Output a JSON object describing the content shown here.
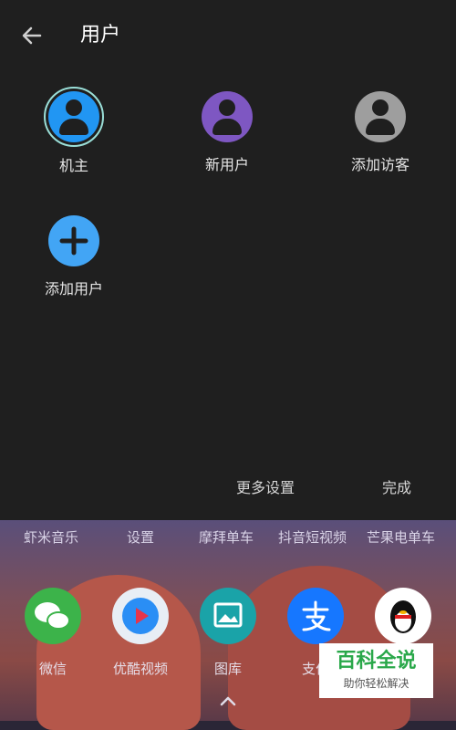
{
  "header": {
    "title": "用户",
    "back_icon": "arrow-left-icon"
  },
  "users": [
    {
      "label": "机主",
      "color": "#2196f3",
      "icon": "person-icon"
    },
    {
      "label": "新用户",
      "color": "#7e57c2",
      "icon": "person-icon"
    },
    {
      "label": "添加访客",
      "color": "#9e9e9e",
      "icon": "person-icon"
    },
    {
      "label": "添加用户",
      "color": "#42a5f5",
      "icon": "plus-icon"
    }
  ],
  "actions": {
    "more_settings": "更多设置",
    "done": "完成"
  },
  "home": {
    "top_row": [
      "虾米音乐",
      "设置",
      "摩拜单车",
      "抖音短视频",
      "芒果电单车"
    ],
    "dock": [
      {
        "label": "微信",
        "color": "#3cb34a",
        "icon": "wechat-icon"
      },
      {
        "label": "优酷视频",
        "color": "#e8eef5",
        "icon": "youku-icon"
      },
      {
        "label": "图库",
        "color": "#1aa3a8",
        "icon": "gallery-icon"
      },
      {
        "label": "支付宝",
        "color": "#1677ff",
        "icon": "alipay-icon"
      },
      {
        "label": "QQ",
        "color": "#ffffff",
        "icon": "qq-penguin-icon"
      }
    ],
    "dock_visible_labels": [
      "微信",
      "优酷视频",
      "图库",
      "支付"
    ]
  },
  "watermark": {
    "title": "百科全说",
    "subtitle": "助你轻松解决"
  }
}
